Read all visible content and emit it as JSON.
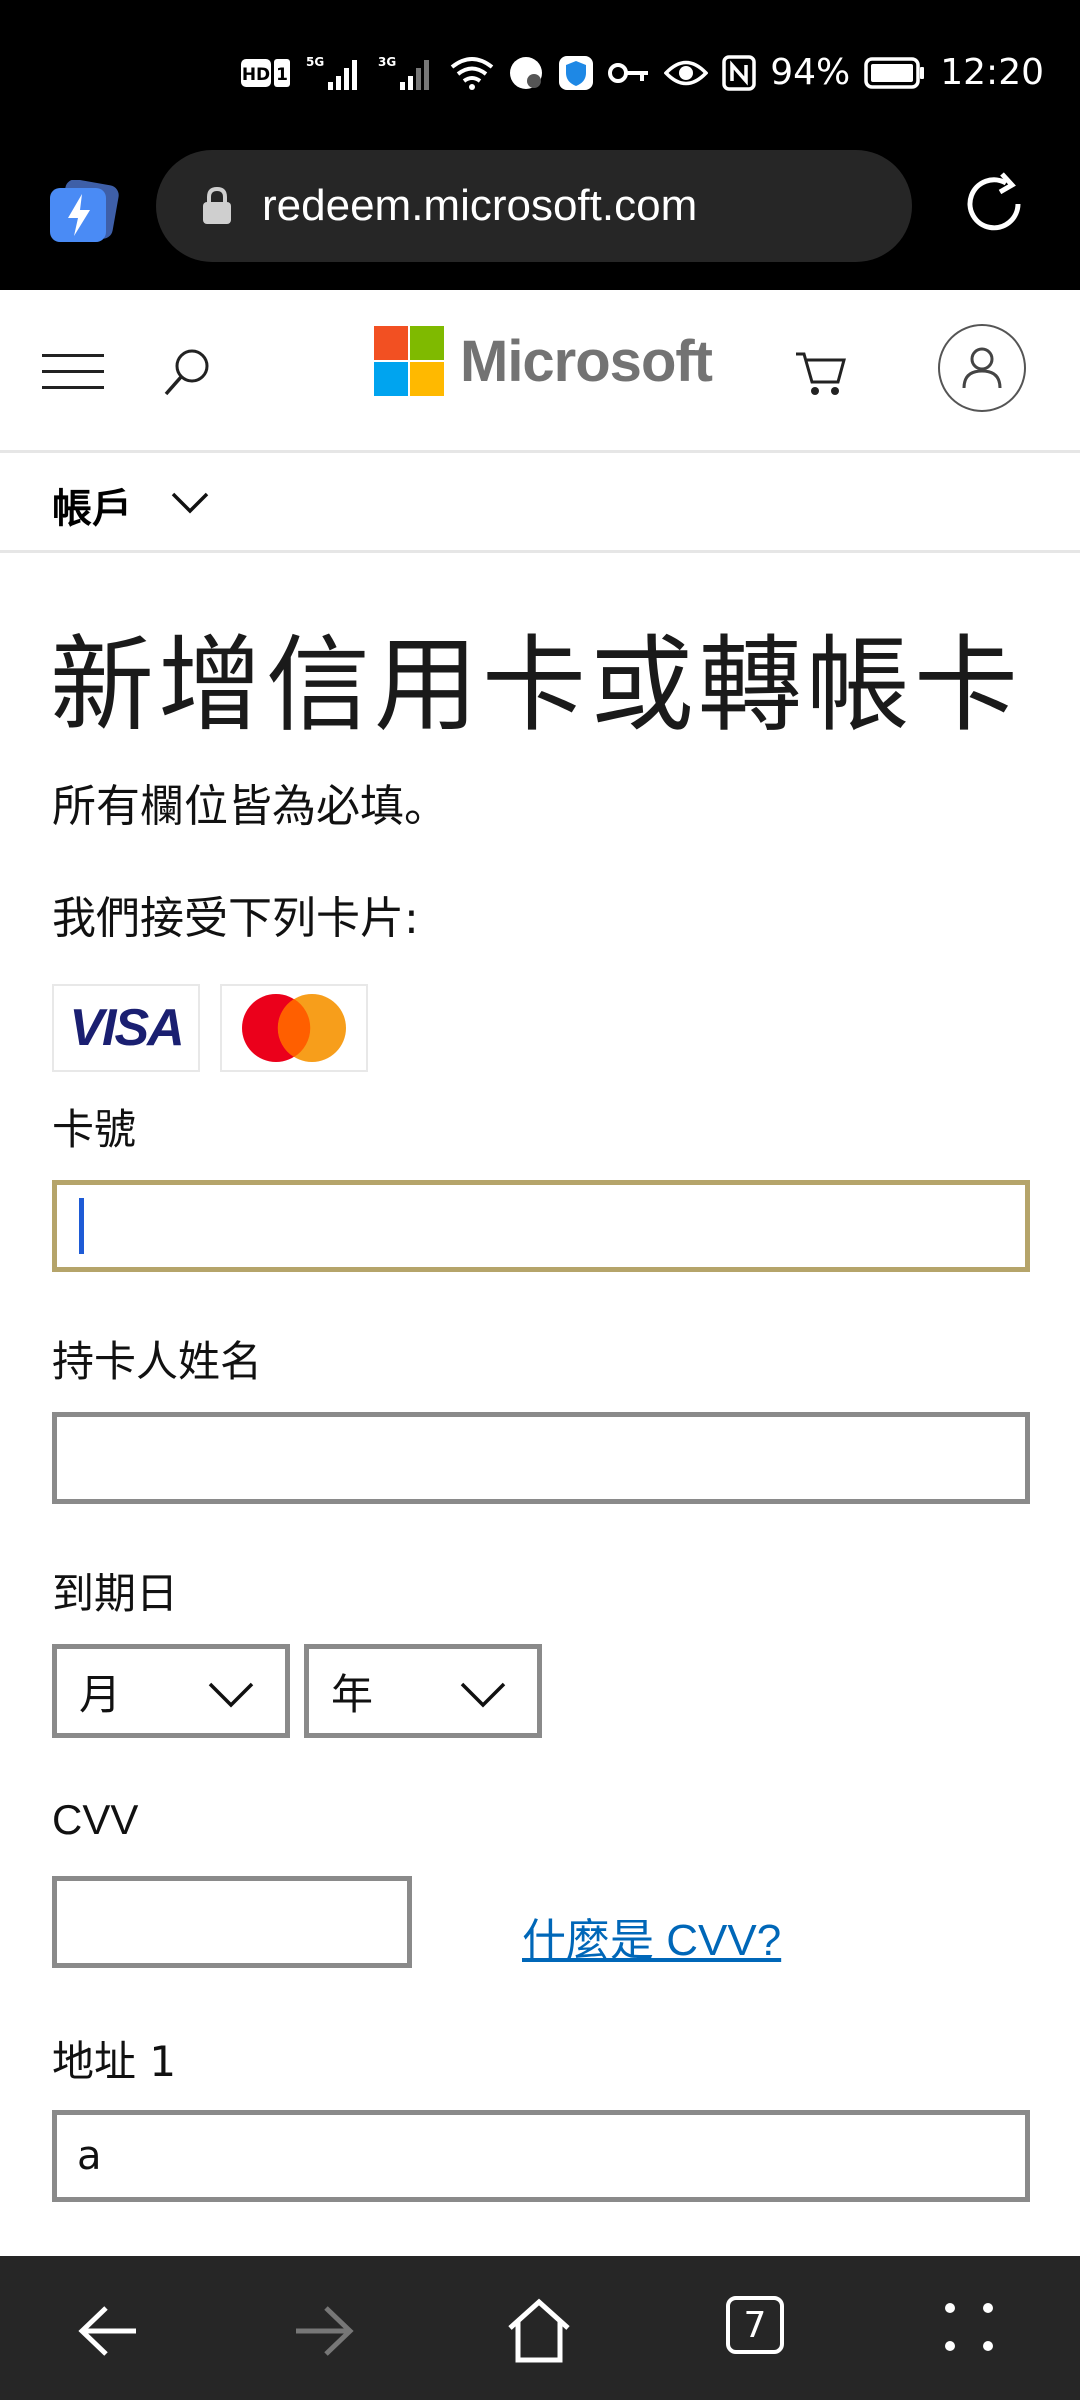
{
  "status_bar": {
    "battery": "94%",
    "time": "12:20",
    "network_5g": "5G",
    "network_3g": "3G"
  },
  "browser": {
    "url": "redeem.microsoft.com",
    "tab_count": "7"
  },
  "header": {
    "brand": "Microsoft"
  },
  "account": {
    "label": "帳戶"
  },
  "page": {
    "title": "新增信用卡或轉帳卡",
    "required_note": "所有欄位皆為必填。",
    "accepted_cards_note": "我們接受下列卡片:",
    "visa_label": "VISA"
  },
  "form": {
    "card_number_label": "卡號",
    "card_number_value": "",
    "cardholder_label": "持卡人姓名",
    "cardholder_value": "",
    "expiry_label": "到期日",
    "month_value": "月",
    "year_value": "年",
    "cvv_label": "CVV",
    "cvv_value": "",
    "cvv_help": "什麼是 CVV?",
    "address1_label": "地址 1",
    "address1_value": "a"
  },
  "colors": {
    "focus_border": "#b5a46a",
    "link": "#0067b8",
    "ms_red": "#f25022",
    "ms_green": "#7fba00",
    "ms_blue": "#00a4ef",
    "ms_yellow": "#ffb900"
  }
}
